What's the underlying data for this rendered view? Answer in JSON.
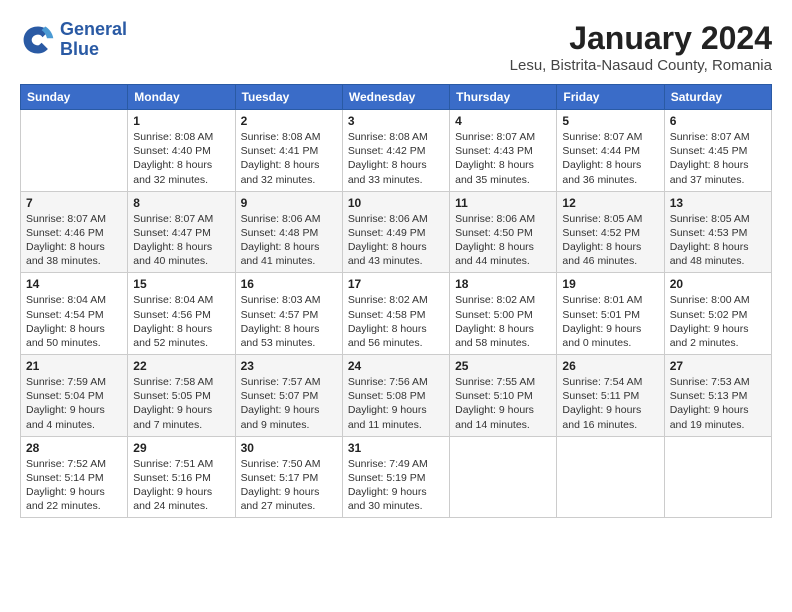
{
  "logo": {
    "text_general": "General",
    "text_blue": "Blue"
  },
  "title": "January 2024",
  "subtitle": "Lesu, Bistrita-Nasaud County, Romania",
  "weekdays": [
    "Sunday",
    "Monday",
    "Tuesday",
    "Wednesday",
    "Thursday",
    "Friday",
    "Saturday"
  ],
  "weeks": [
    [
      {
        "day": "",
        "info": ""
      },
      {
        "day": "1",
        "info": "Sunrise: 8:08 AM\nSunset: 4:40 PM\nDaylight: 8 hours\nand 32 minutes."
      },
      {
        "day": "2",
        "info": "Sunrise: 8:08 AM\nSunset: 4:41 PM\nDaylight: 8 hours\nand 32 minutes."
      },
      {
        "day": "3",
        "info": "Sunrise: 8:08 AM\nSunset: 4:42 PM\nDaylight: 8 hours\nand 33 minutes."
      },
      {
        "day": "4",
        "info": "Sunrise: 8:07 AM\nSunset: 4:43 PM\nDaylight: 8 hours\nand 35 minutes."
      },
      {
        "day": "5",
        "info": "Sunrise: 8:07 AM\nSunset: 4:44 PM\nDaylight: 8 hours\nand 36 minutes."
      },
      {
        "day": "6",
        "info": "Sunrise: 8:07 AM\nSunset: 4:45 PM\nDaylight: 8 hours\nand 37 minutes."
      }
    ],
    [
      {
        "day": "7",
        "info": "Sunrise: 8:07 AM\nSunset: 4:46 PM\nDaylight: 8 hours\nand 38 minutes."
      },
      {
        "day": "8",
        "info": "Sunrise: 8:07 AM\nSunset: 4:47 PM\nDaylight: 8 hours\nand 40 minutes."
      },
      {
        "day": "9",
        "info": "Sunrise: 8:06 AM\nSunset: 4:48 PM\nDaylight: 8 hours\nand 41 minutes."
      },
      {
        "day": "10",
        "info": "Sunrise: 8:06 AM\nSunset: 4:49 PM\nDaylight: 8 hours\nand 43 minutes."
      },
      {
        "day": "11",
        "info": "Sunrise: 8:06 AM\nSunset: 4:50 PM\nDaylight: 8 hours\nand 44 minutes."
      },
      {
        "day": "12",
        "info": "Sunrise: 8:05 AM\nSunset: 4:52 PM\nDaylight: 8 hours\nand 46 minutes."
      },
      {
        "day": "13",
        "info": "Sunrise: 8:05 AM\nSunset: 4:53 PM\nDaylight: 8 hours\nand 48 minutes."
      }
    ],
    [
      {
        "day": "14",
        "info": "Sunrise: 8:04 AM\nSunset: 4:54 PM\nDaylight: 8 hours\nand 50 minutes."
      },
      {
        "day": "15",
        "info": "Sunrise: 8:04 AM\nSunset: 4:56 PM\nDaylight: 8 hours\nand 52 minutes."
      },
      {
        "day": "16",
        "info": "Sunrise: 8:03 AM\nSunset: 4:57 PM\nDaylight: 8 hours\nand 53 minutes."
      },
      {
        "day": "17",
        "info": "Sunrise: 8:02 AM\nSunset: 4:58 PM\nDaylight: 8 hours\nand 56 minutes."
      },
      {
        "day": "18",
        "info": "Sunrise: 8:02 AM\nSunset: 5:00 PM\nDaylight: 8 hours\nand 58 minutes."
      },
      {
        "day": "19",
        "info": "Sunrise: 8:01 AM\nSunset: 5:01 PM\nDaylight: 9 hours\nand 0 minutes."
      },
      {
        "day": "20",
        "info": "Sunrise: 8:00 AM\nSunset: 5:02 PM\nDaylight: 9 hours\nand 2 minutes."
      }
    ],
    [
      {
        "day": "21",
        "info": "Sunrise: 7:59 AM\nSunset: 5:04 PM\nDaylight: 9 hours\nand 4 minutes."
      },
      {
        "day": "22",
        "info": "Sunrise: 7:58 AM\nSunset: 5:05 PM\nDaylight: 9 hours\nand 7 minutes."
      },
      {
        "day": "23",
        "info": "Sunrise: 7:57 AM\nSunset: 5:07 PM\nDaylight: 9 hours\nand 9 minutes."
      },
      {
        "day": "24",
        "info": "Sunrise: 7:56 AM\nSunset: 5:08 PM\nDaylight: 9 hours\nand 11 minutes."
      },
      {
        "day": "25",
        "info": "Sunrise: 7:55 AM\nSunset: 5:10 PM\nDaylight: 9 hours\nand 14 minutes."
      },
      {
        "day": "26",
        "info": "Sunrise: 7:54 AM\nSunset: 5:11 PM\nDaylight: 9 hours\nand 16 minutes."
      },
      {
        "day": "27",
        "info": "Sunrise: 7:53 AM\nSunset: 5:13 PM\nDaylight: 9 hours\nand 19 minutes."
      }
    ],
    [
      {
        "day": "28",
        "info": "Sunrise: 7:52 AM\nSunset: 5:14 PM\nDaylight: 9 hours\nand 22 minutes."
      },
      {
        "day": "29",
        "info": "Sunrise: 7:51 AM\nSunset: 5:16 PM\nDaylight: 9 hours\nand 24 minutes."
      },
      {
        "day": "30",
        "info": "Sunrise: 7:50 AM\nSunset: 5:17 PM\nDaylight: 9 hours\nand 27 minutes."
      },
      {
        "day": "31",
        "info": "Sunrise: 7:49 AM\nSunset: 5:19 PM\nDaylight: 9 hours\nand 30 minutes."
      },
      {
        "day": "",
        "info": ""
      },
      {
        "day": "",
        "info": ""
      },
      {
        "day": "",
        "info": ""
      }
    ]
  ]
}
